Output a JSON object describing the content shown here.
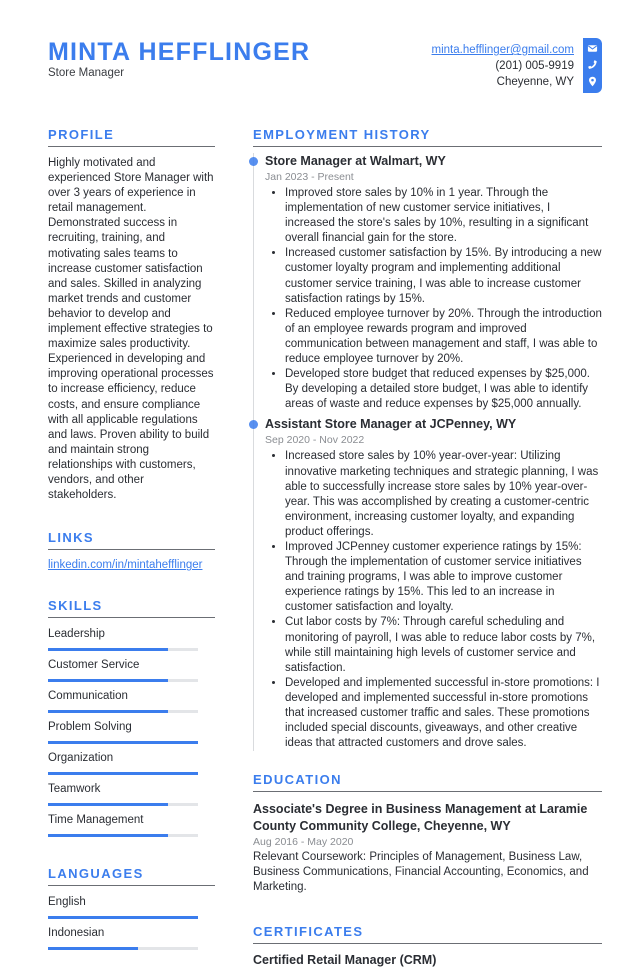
{
  "header": {
    "name": "MINTA HEFFLINGER",
    "title": "Store Manager",
    "email": "minta.hefflinger@gmail.com",
    "phone": "(201) 005-9919",
    "location": "Cheyenne, WY",
    "icons": [
      "envelope-icon",
      "phone-icon",
      "location-pin-icon"
    ],
    "accent_color": "#3b7ded"
  },
  "left": {
    "profile": {
      "title": "PROFILE",
      "text": "Highly motivated and experienced Store Manager with over 3 years of experience in retail management. Demonstrated success in recruiting, training, and motivating sales teams to increase customer satisfaction and sales. Skilled in analyzing market trends and customer behavior to develop and implement effective strategies to maximize sales productivity. Experienced in developing and improving operational processes to increase efficiency, reduce costs, and ensure compliance with all applicable regulations and laws. Proven ability to build and maintain strong relationships with customers, vendors, and other stakeholders."
    },
    "links": {
      "title": "LINKS",
      "items": [
        "linkedin.com/in/mintahefflinger"
      ]
    },
    "skills": {
      "title": "SKILLS",
      "items": [
        {
          "label": "Leadership",
          "level": 0.8
        },
        {
          "label": "Customer Service",
          "level": 0.8
        },
        {
          "label": "Communication",
          "level": 0.8
        },
        {
          "label": "Problem Solving",
          "level": 1.0
        },
        {
          "label": "Organization",
          "level": 1.0
        },
        {
          "label": "Teamwork",
          "level": 0.8
        },
        {
          "label": "Time Management",
          "level": 0.8
        }
      ]
    },
    "languages": {
      "title": "LANGUAGES",
      "items": [
        {
          "label": "English",
          "level": 1.0
        },
        {
          "label": "Indonesian",
          "level": 0.6
        }
      ]
    }
  },
  "right": {
    "employment": {
      "title": "EMPLOYMENT HISTORY",
      "jobs": [
        {
          "title": "Store Manager at Walmart, WY",
          "date": "Jan 2023 - Present",
          "bullets": [
            "Improved store sales by 10% in 1 year.  Through the implementation of new customer service initiatives, I increased the store's sales by 10%, resulting in a significant overall financial gain for the store.",
            "Increased customer satisfaction by 15%. By introducing a new customer loyalty program and implementing additional customer service training, I was able to increase customer satisfaction ratings by 15%.",
            "Reduced employee turnover by 20%. Through the introduction of an employee rewards program and improved communication between management and staff, I was able to reduce employee turnover by 20%.",
            "Developed store budget that reduced expenses by $25,000. By developing a detailed store budget, I was able to identify areas of waste and reduce expenses by $25,000 annually."
          ]
        },
        {
          "title": "Assistant Store Manager at JCPenney, WY",
          "date": "Sep 2020 - Nov 2022",
          "bullets": [
            "Increased store sales by 10% year-over-year: Utilizing innovative marketing techniques and strategic planning, I was able to successfully increase store sales by 10% year-over-year. This was accomplished by creating a customer-centric environment, increasing customer loyalty, and expanding product offerings.",
            "Improved JCPenney customer experience ratings by 15%: Through the implementation of customer service initiatives and training programs, I was able to improve customer experience ratings by 15%. This led to an increase in customer satisfaction and loyalty.",
            "Cut labor costs by 7%: Through careful scheduling and monitoring of payroll, I was able to reduce labor costs by 7%, while still maintaining high levels of customer service and satisfaction.",
            "Developed and implemented successful in-store promotions: I developed and implemented successful in-store promotions that increased customer traffic and sales. These promotions included special discounts, giveaways, and other creative ideas that attracted customers and drove sales."
          ]
        }
      ]
    },
    "education": {
      "title": "EDUCATION",
      "degree": "Associate's Degree in Business Management at Laramie County Community College, Cheyenne, WY",
      "date": "Aug 2016 - May 2020",
      "description": "Relevant Coursework: Principles of Management, Business Law, Business Communications, Financial Accounting, Economics, and Marketing."
    },
    "certificates": {
      "title": "CERTIFICATES",
      "items": [
        "Certified Retail Manager (CRM)"
      ]
    }
  }
}
